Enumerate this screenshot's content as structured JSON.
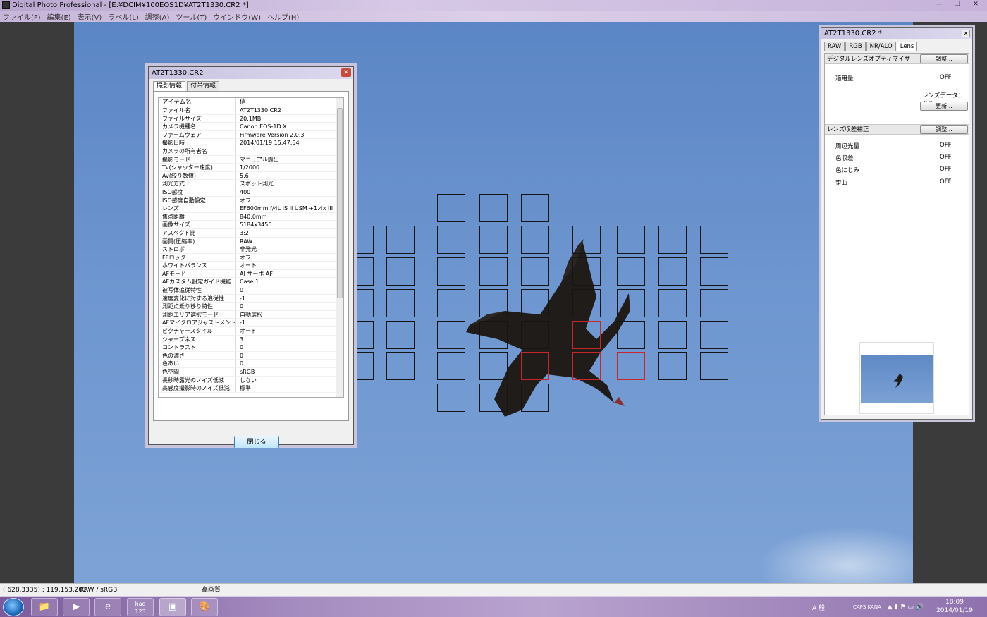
{
  "window": {
    "title": "Digital Photo Professional - [E:¥DCIM¥100EOS1D¥AT2T1330.CR2 *]"
  },
  "menu": [
    "ファイル(F)",
    "編集(E)",
    "表示(V)",
    "ラベル(L)",
    "調整(A)",
    "ツール(T)",
    "ウインドウ(W)",
    "ヘルプ(H)"
  ],
  "info_dialog": {
    "title": "AT2T1330.CR2",
    "tabs": [
      "撮影情報",
      "付帯情報"
    ],
    "col_item": "アイテム名",
    "col_value": "値",
    "rows": [
      [
        "ファイル名",
        "AT2T1330.CR2"
      ],
      [
        "ファイルサイズ",
        "20.1MB"
      ],
      [
        "カメラ機種名",
        "Canon EOS-1D X"
      ],
      [
        "ファームウェア",
        "Firmware Version 2.0.3"
      ],
      [
        "撮影日時",
        "2014/01/19 15:47:54"
      ],
      [
        "カメラの所有者名",
        ""
      ],
      [
        "撮影モード",
        "マニュアル露出"
      ],
      [
        "Tv(シャッター速度)",
        "1/2000"
      ],
      [
        "Av(絞り数値)",
        "5.6"
      ],
      [
        "測光方式",
        "スポット測光"
      ],
      [
        "ISO感度",
        "400"
      ],
      [
        "ISO感度自動設定",
        "オフ"
      ],
      [
        "レンズ",
        "EF600mm f/4L IS II USM +1.4x III"
      ],
      [
        "焦点距離",
        "840.0mm"
      ],
      [
        "画像サイズ",
        "5184x3456"
      ],
      [
        "アスペクト比",
        "3:2"
      ],
      [
        "画質(圧縮率)",
        "RAW"
      ],
      [
        "ストロボ",
        "非発光"
      ],
      [
        "FEロック",
        "オフ"
      ],
      [
        "ホワイトバランス",
        "オート"
      ],
      [
        "AFモード",
        "AI サーボ AF"
      ],
      [
        "AFカスタム設定ガイド機能",
        "Case 1"
      ],
      [
        "被写体追従特性",
        "0"
      ],
      [
        "速度変化に対する追従性",
        "-1"
      ],
      [
        "測距点乗り移り特性",
        "0"
      ],
      [
        "測距エリア選択モード",
        "自動選択"
      ],
      [
        "AFマイクロアジャストメント",
        "-1"
      ],
      [
        "ピクチャースタイル",
        "オート"
      ],
      [
        "シャープネス",
        "3"
      ],
      [
        "コントラスト",
        "0"
      ],
      [
        "色の濃さ",
        "0"
      ],
      [
        "色あい",
        "0"
      ],
      [
        "色空間",
        "sRGB"
      ],
      [
        "長秒時露光のノイズ低減",
        "しない"
      ],
      [
        "高感度撮影時のノイズ低減",
        "標準"
      ]
    ],
    "close_label": "閉じる"
  },
  "tool_palette": {
    "title": "AT2T1330.CR2 *",
    "tabs": [
      "RAW",
      "RGB",
      "NR/ALO",
      "Lens"
    ],
    "dlo": {
      "header": "デジタルレンズオプティマイザ",
      "adjust": "調整...",
      "amount_label": "適用量",
      "amount_value": "OFF",
      "lens_data": "レンズデータ：あり",
      "update": "更新..."
    },
    "aberration": {
      "header": "レンズ収差補正",
      "adjust": "調整...",
      "items": [
        [
          "周辺光量",
          "OFF"
        ],
        [
          "色収差",
          "OFF"
        ],
        [
          "色にじみ",
          "OFF"
        ],
        [
          "歪曲",
          "OFF"
        ]
      ]
    }
  },
  "status": {
    "coords": "( 628,3335) : 119,153,201",
    "colorspace": "RAW / sRGB",
    "quality": "高画質"
  },
  "taskbar": {
    "apps": [
      "explorer",
      "media",
      "ie",
      "hao123",
      "dpp",
      "paint"
    ],
    "hao_label": "hao\n123",
    "time": "18:09",
    "date": "2014/01/19",
    "ime": "A 般",
    "caps": "CAPS KANA"
  }
}
